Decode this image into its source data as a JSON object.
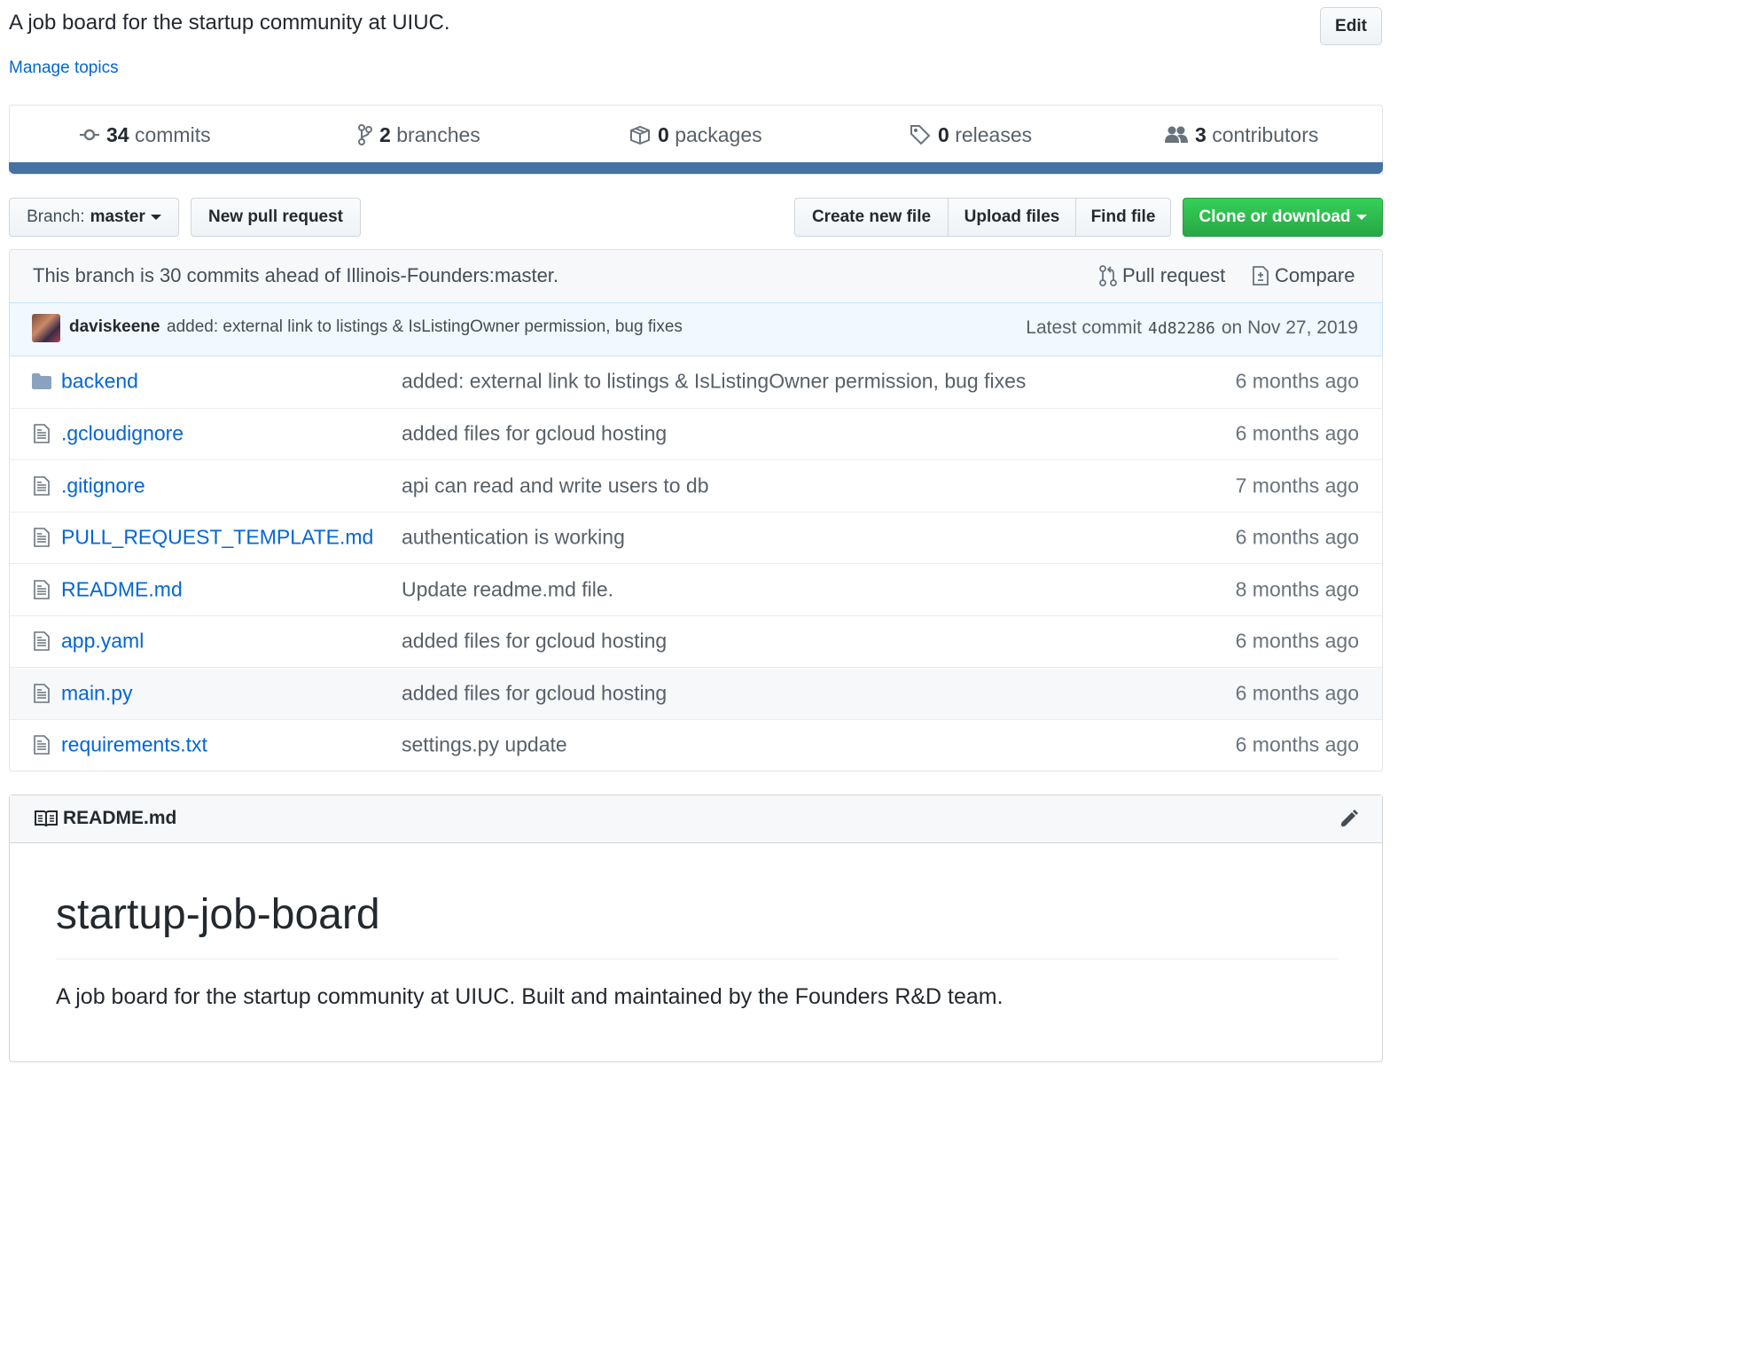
{
  "repo": {
    "description": "A job board for the startup community at UIUC.",
    "manage_topics": "Manage topics",
    "edit_label": "Edit"
  },
  "summary": {
    "commits": {
      "count": "34",
      "label": "commits",
      "icon": "commit-icon"
    },
    "branches": {
      "count": "2",
      "label": "branches",
      "icon": "branch-icon"
    },
    "packages": {
      "count": "0",
      "label": "packages",
      "icon": "package-icon"
    },
    "releases": {
      "count": "0",
      "label": "releases",
      "icon": "tag-icon"
    },
    "contributors": {
      "count": "3",
      "label": "contributors",
      "icon": "people-icon"
    },
    "language_bar_color": "#4472a3"
  },
  "toolbar": {
    "branch_prefix": "Branch:",
    "branch_name": "master",
    "new_pull_request": "New pull request",
    "create_new_file": "Create new file",
    "upload_files": "Upload files",
    "find_file": "Find file",
    "clone_or_download": "Clone or download",
    "clone_color": "#28a745"
  },
  "branch_info": {
    "text": "This branch is 30 commits ahead of Illinois-Founders:master.",
    "pull_request": "Pull request",
    "compare": "Compare"
  },
  "latest_commit": {
    "author": "daviskeene",
    "message": "added: external link to listings & IsListingOwner permission, bug fixes",
    "label": "Latest commit",
    "sha": "4d82286",
    "date": "on Nov 27, 2019"
  },
  "files": [
    {
      "name": "backend",
      "type": "folder",
      "message": "added: external link to listings & IsListingOwner permission, bug fixes",
      "age": "6 months ago"
    },
    {
      "name": ".gcloudignore",
      "type": "file",
      "message": "added files for gcloud hosting",
      "age": "6 months ago"
    },
    {
      "name": ".gitignore",
      "type": "file",
      "message": "api can read and write users to db",
      "age": "7 months ago"
    },
    {
      "name": "PULL_REQUEST_TEMPLATE.md",
      "type": "file",
      "message": "authentication is working",
      "age": "6 months ago"
    },
    {
      "name": "README.md",
      "type": "file",
      "message": "Update readme.md file.",
      "age": "8 months ago"
    },
    {
      "name": "app.yaml",
      "type": "file",
      "message": "added files for gcloud hosting",
      "age": "6 months ago"
    },
    {
      "name": "main.py",
      "type": "file",
      "message": "added files for gcloud hosting",
      "age": "6 months ago"
    },
    {
      "name": "requirements.txt",
      "type": "file",
      "message": "settings.py update",
      "age": "6 months ago"
    }
  ],
  "readme": {
    "filename": "README.md",
    "heading": "startup-job-board",
    "body": "A job board for the startup community at UIUC. Built and maintained by the Founders R&D team."
  }
}
